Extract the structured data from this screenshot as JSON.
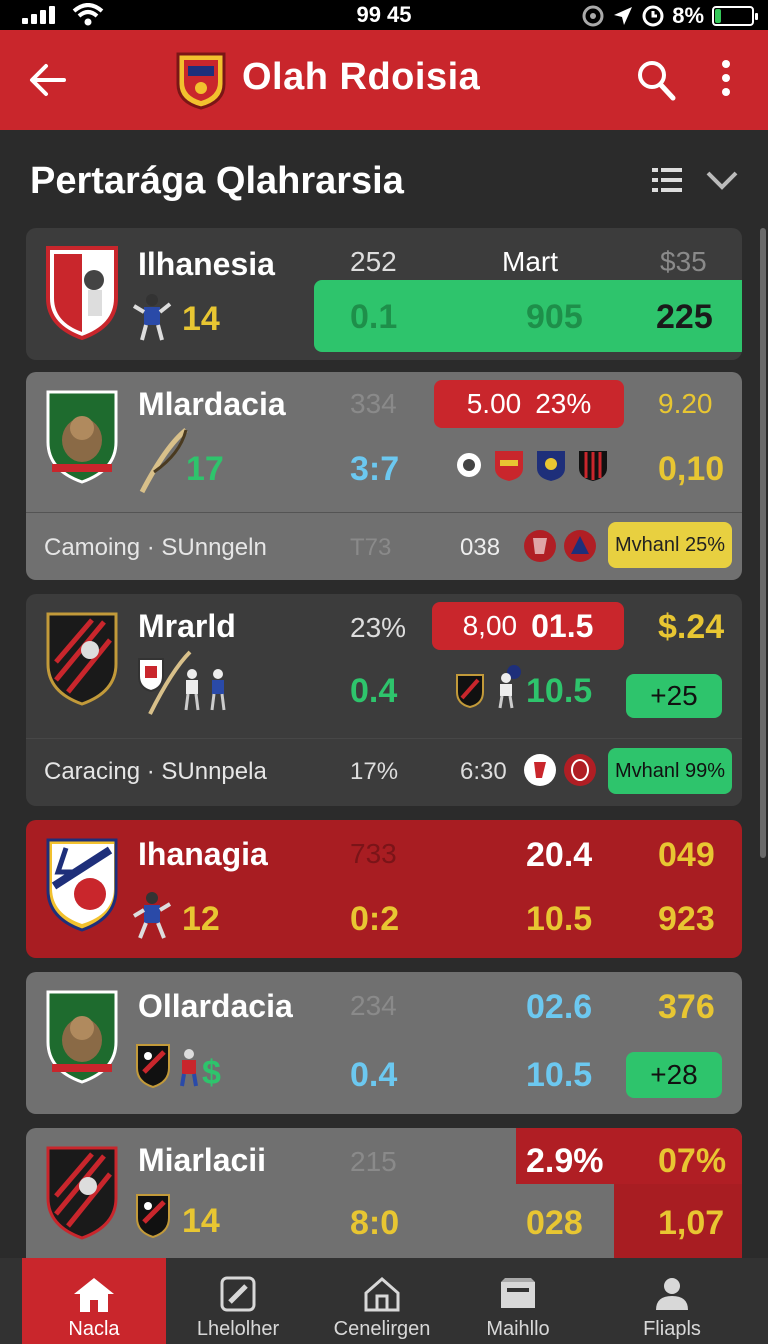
{
  "status_bar": {
    "time": "99 45",
    "battery_text": "8%"
  },
  "app_bar": {
    "title": "Olah Rdoisia"
  },
  "section": {
    "title": "Pertarága Qlahrarsia"
  },
  "colors": {
    "brand_red": "#c9262c",
    "accent_green": "#2ec46c",
    "accent_yellow": "#e8c632",
    "accent_blue": "#6cc8f0"
  },
  "cards": [
    {
      "team": "Ilhanesia",
      "badge": "14",
      "col1_top": "252",
      "col2_top": "Mart",
      "col3_top": "$35",
      "col1_bottom": "0.1",
      "col2_bottom": "905",
      "col3_bottom": "225"
    },
    {
      "team": "Mlardacia",
      "badge": "17",
      "col1_top": "334",
      "chip_top_a": "5.00",
      "chip_top_b": "23%",
      "col3_top": "9.20",
      "col1_bottom": "3:7",
      "col3_bottom": "0,10",
      "sub_label": "Camoing · SUnngeln",
      "sub_col1": "T73",
      "sub_col2": "038",
      "sub_chip": "Mvhanl 25%"
    },
    {
      "team": "Mrarld",
      "badge": "",
      "col1_top": "23%",
      "chip_top_a": "8,00",
      "chip_top_b": "01.5",
      "col3_top": "$.24",
      "col1_bottom": "0.4",
      "col2_bottom": "10.5",
      "col3_chip": "+25",
      "sub_label": "Caracing · SUnnpela",
      "sub_col1": "17%",
      "sub_col2": "6:30",
      "sub_chip": "Mvhanl 99%"
    },
    {
      "team": "Ihanagia",
      "badge": "12",
      "col1_top": "733",
      "col2_top": "20.4",
      "col3_top": "049",
      "col1_bottom": "0:2",
      "col2_bottom": "10.5",
      "col3_bottom": "923"
    },
    {
      "team": "Ollardacia",
      "badge": "$",
      "col1_top": "234",
      "col2_top": "02.6",
      "col3_top": "376",
      "col1_bottom": "0.4",
      "col2_bottom": "10.5",
      "col3_chip": "+28"
    },
    {
      "team": "Miarlacii",
      "badge": "14",
      "col1_top": "215",
      "col2_top": "2.9%",
      "col3_top": "07%",
      "col1_bottom": "8:0",
      "col2_bottom": "028",
      "col3_bottom": "1,07"
    }
  ],
  "bottom_nav": [
    {
      "label": "Nacla",
      "icon": "home-icon"
    },
    {
      "label": "Lhelolher",
      "icon": "edit-icon"
    },
    {
      "label": "Cenelirgen",
      "icon": "house-icon"
    },
    {
      "label": "Maihllo",
      "icon": "inbox-icon"
    },
    {
      "label": "Fliapls",
      "icon": "person-icon"
    }
  ]
}
